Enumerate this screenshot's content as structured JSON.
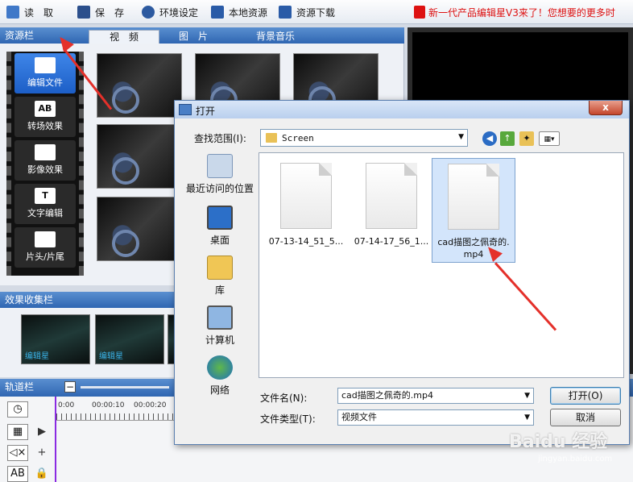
{
  "toolbar": {
    "items": [
      {
        "label": "读　取",
        "icon": "folder-open-icon"
      },
      {
        "label": "保　存",
        "icon": "save-icon"
      },
      {
        "label": "环境设定",
        "icon": "gear-icon"
      },
      {
        "label": "本地资源",
        "icon": "upload-icon"
      },
      {
        "label": "资源下载",
        "icon": "download-icon"
      }
    ],
    "marquee": "新一代产品编辑星V3来了！您想要的更多时"
  },
  "resources": {
    "title": "资源栏",
    "tabs": [
      "视　频",
      "图　片",
      "背景音乐"
    ],
    "modes": [
      "编辑文件",
      "转场效果",
      "影像效果",
      "文字编辑",
      "片头/片尾"
    ],
    "mode_icons": [
      "film-icon",
      "ab-icon",
      "effect-icon",
      "text-icon",
      "clip-icon"
    ],
    "mode_glyphs": [
      "",
      "AB",
      "",
      "T",
      ""
    ]
  },
  "effects": {
    "title": "效果收集栏",
    "thumb_label": "编辑星"
  },
  "track": {
    "title": "轨道栏",
    "ruler": [
      "0:00",
      "00:00:10",
      "00:00:20"
    ]
  },
  "dialog": {
    "title": "打开",
    "close": "x",
    "lookin_label": "查找范围(I):",
    "lookin_value": "Screen",
    "places": [
      "最近访问的位置",
      "桌面",
      "库",
      "计算机",
      "网络"
    ],
    "files": [
      {
        "name": "07-13-14_51_5..."
      },
      {
        "name": "07-14-17_56_1..."
      },
      {
        "name": "cad描图之佩奇的.mp4",
        "selected": true
      }
    ],
    "filename_label": "文件名(N):",
    "filename_value": "cad描图之佩奇的.mp4",
    "filetype_label": "文件类型(T):",
    "filetype_value": "视频文件",
    "open_button": "打开(O)",
    "cancel_button": "取消"
  },
  "watermark": {
    "main": "Baidu 经验",
    "sub": "jingyan.baidu.com"
  },
  "colors": {
    "accent": "#2f66b2",
    "arrow": "#e4302a",
    "selection": "#d3e5fb"
  }
}
